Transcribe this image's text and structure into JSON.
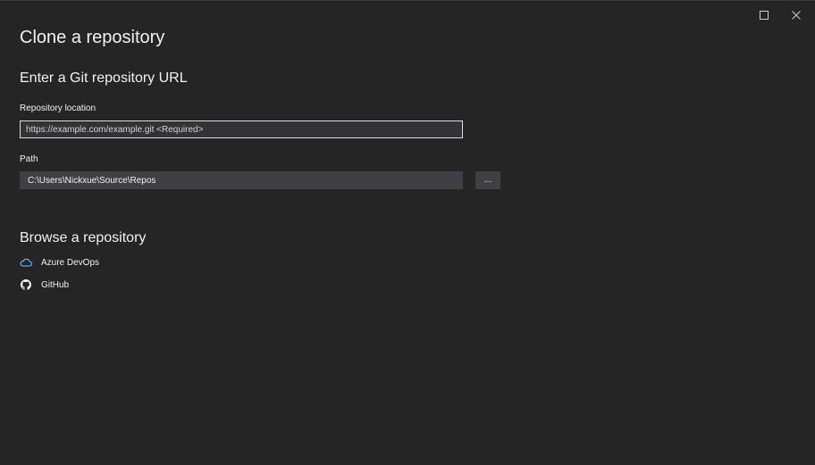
{
  "dialog": {
    "title": "Clone a repository",
    "controls": [
      "maximize-icon",
      "close-icon"
    ]
  },
  "url_section": {
    "heading": "Enter a Git repository URL",
    "repository_location": {
      "label": "Repository location",
      "value": "",
      "placeholder": "https://example.com/example.git <Required>"
    },
    "path": {
      "label": "Path",
      "value": "C:\\Users\\Nickxue\\Source\\Repos",
      "browse_label": "..."
    }
  },
  "browse_section": {
    "heading": "Browse a repository",
    "providers": [
      {
        "label": "Azure DevOps",
        "icon": "cloud-icon",
        "icon_color": "#75beff"
      },
      {
        "label": "GitHub",
        "icon": "github-icon",
        "icon_color": "#f1f1f1"
      }
    ]
  },
  "colors": {
    "background": "#252526",
    "text": "#f1f1f1",
    "input_background": "#3f3f46",
    "input_border_focused": "#dcdcdc"
  }
}
